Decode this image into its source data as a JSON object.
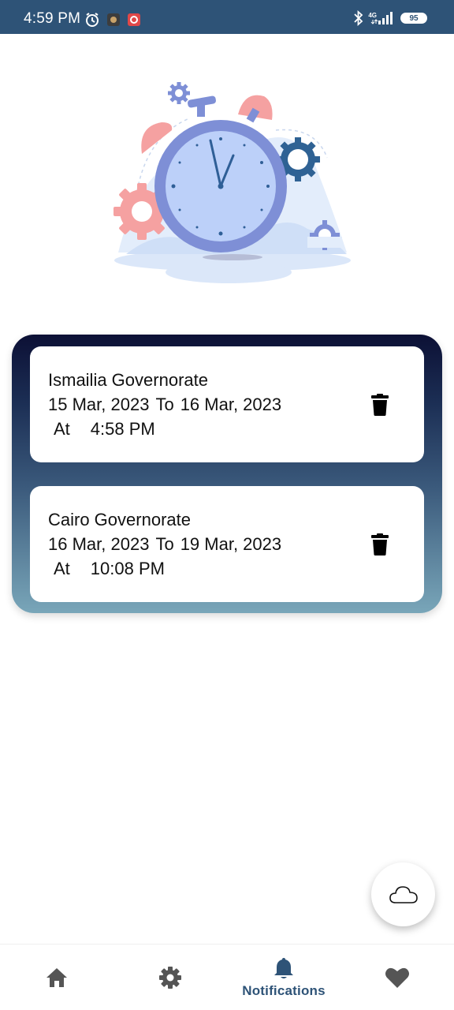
{
  "status_bar": {
    "time": "4:59 PM",
    "network": "4G",
    "battery": "95"
  },
  "notifications": [
    {
      "location": "Ismailia Governorate",
      "start_date": "15 Mar, 2023",
      "to_label": "To",
      "end_date": "16 Mar, 2023",
      "at_label": "At",
      "time": "4:58 PM"
    },
    {
      "location": "Cairo Governorate",
      "start_date": "16 Mar, 2023",
      "to_label": "To",
      "end_date": "19 Mar, 2023",
      "at_label": "At",
      "time": "10:08 PM"
    }
  ],
  "bottom_nav": {
    "active_label": "Notifications"
  },
  "colors": {
    "accent": "#2e5377",
    "panel_top": "#0c1035",
    "panel_bottom": "#79a6b9"
  }
}
